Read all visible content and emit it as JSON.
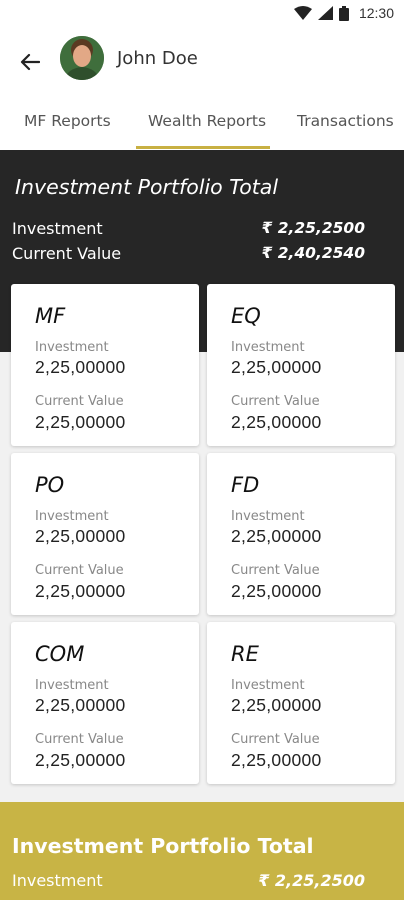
{
  "status_bar": {
    "time": "12:30"
  },
  "header": {
    "user_name": "John Doe"
  },
  "tabs": [
    {
      "label": "MF Reports"
    },
    {
      "label": "Wealth Reports"
    },
    {
      "label": "Transactions"
    }
  ],
  "summary": {
    "title": "Investment Portfolio Total",
    "investment_label": "Investment",
    "investment_value": "₹ 2,25,2500",
    "current_label": "Current Value",
    "current_value": "₹ 2,40,2540"
  },
  "cards": [
    {
      "code": "MF",
      "investment_label": "Investment",
      "investment": "2,25,00000",
      "current_label": "Current Value",
      "current": "2,25,00000"
    },
    {
      "code": "EQ",
      "investment_label": "Investment",
      "investment": "2,25,00000",
      "current_label": "Current Value",
      "current": "2,25,00000"
    },
    {
      "code": "PO",
      "investment_label": "Investment",
      "investment": "2,25,00000",
      "current_label": "Current Value",
      "current": "2,25,00000"
    },
    {
      "code": "FD",
      "investment_label": "Investment",
      "investment": "2,25,00000",
      "current_label": "Current Value",
      "current": "2,25,00000"
    },
    {
      "code": "COM",
      "investment_label": "Investment",
      "investment": "2,25,00000",
      "current_label": "Current Value",
      "current": "2,25,00000"
    },
    {
      "code": "RE",
      "investment_label": "Investment",
      "investment": "2,25,00000",
      "current_label": "Current Value",
      "current": "2,25,00000"
    }
  ],
  "footer_summary": {
    "title": "Investment Portfolio Total",
    "investment_label": "Investment",
    "investment_value": "₹ 2,25,2500"
  },
  "colors": {
    "accent": "#c8b042",
    "dark_panel": "#262626",
    "gold_panel": "#c8b445"
  }
}
